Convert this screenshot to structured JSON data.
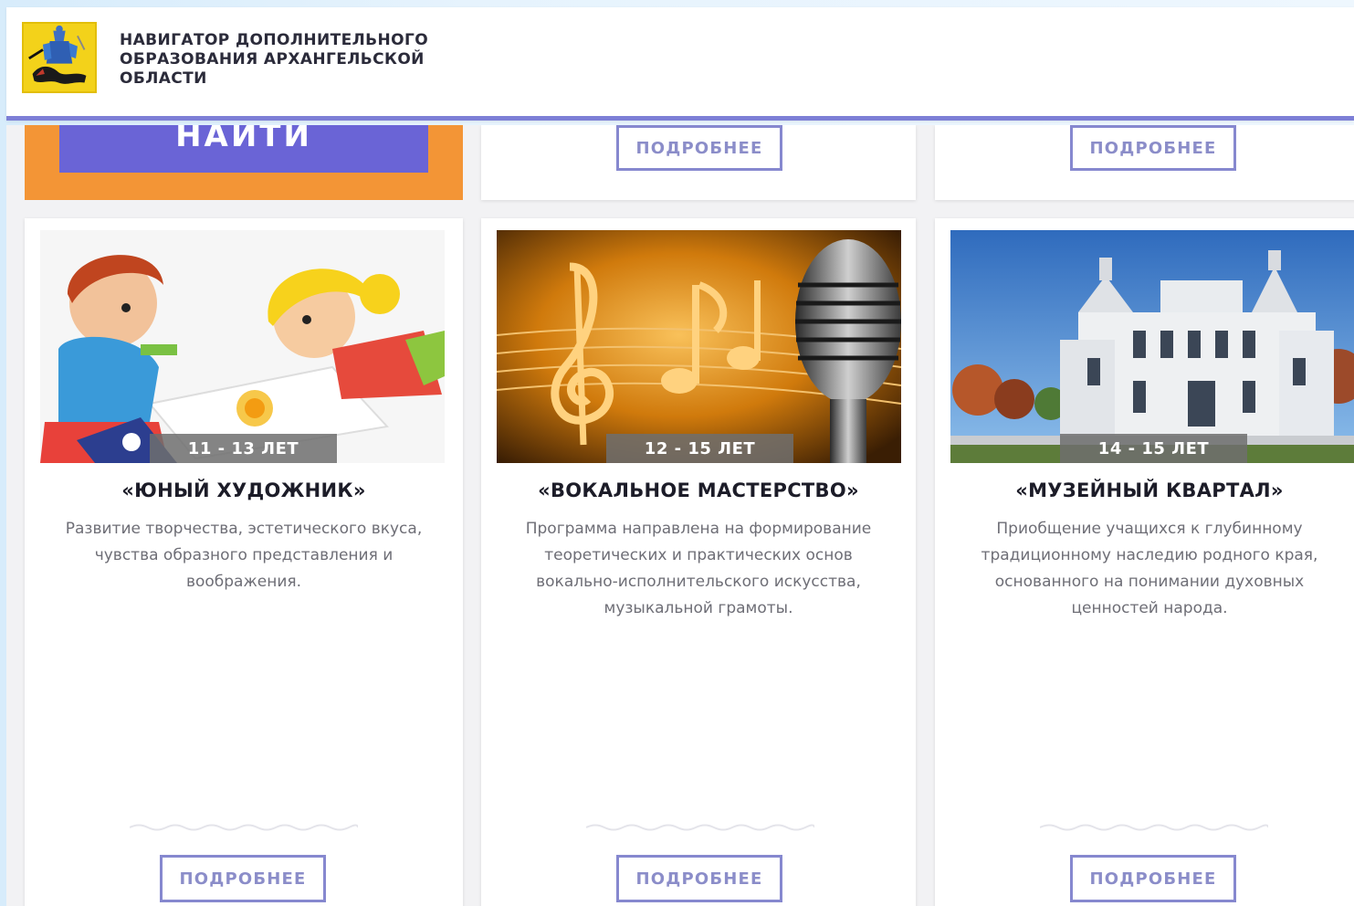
{
  "header": {
    "logo_icon": "coat-of-arms-icon",
    "brand_title": "НАВИГАТОР ДОПОЛНИТЕЛЬНОГО ОБРАЗОВАНИЯ АРХАНГЕЛЬСКОЙ ОБЛАСТИ"
  },
  "search": {
    "button_label": "НАЙТИ"
  },
  "top_cards": [
    {
      "more_label": "ПОДРОБНЕЕ"
    },
    {
      "more_label": "ПОДРОБНЕЕ"
    }
  ],
  "cards": [
    {
      "image": "children-drawing-image",
      "age": "11 - 13 ЛЕТ",
      "title": "«ЮНЫЙ ХУДОЖНИК»",
      "description": "Развитие творчества, эстетического вкуса, чувства образного представления и воображения.",
      "more_label": "ПОДРОБНЕЕ"
    },
    {
      "image": "music-notes-microphone-image",
      "age": "12 - 15 ЛЕТ",
      "title": "«ВОКАЛЬНОЕ МАСТЕРСТВО»",
      "description": "Программа направлена на формирование теоретических и практических основ вокально-исполнительского искусства, музыкальной грамоты.",
      "more_label": "ПОДРОБНЕЕ"
    },
    {
      "image": "historic-mansion-image",
      "age": "14 - 15 ЛЕТ",
      "title": "«МУЗЕЙНЫЙ КВАРТАЛ»",
      "description": "Приобщение учащихся к глубинному традиционному наследию родного края, основанного на понимании духовных ценностей народа.",
      "more_label": "ПОДРОБНЕЕ"
    }
  ],
  "colors": {
    "accent": "#6a64d6",
    "search_block": "#f39536",
    "header_border": "#7d7fd6",
    "button_border": "#8688cf"
  }
}
